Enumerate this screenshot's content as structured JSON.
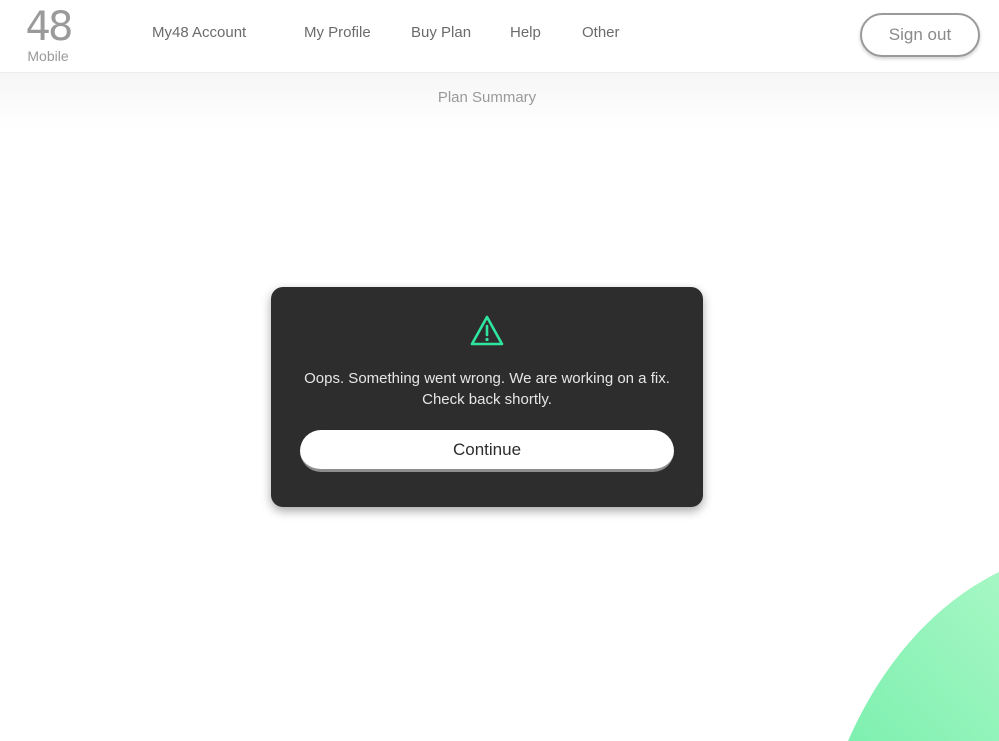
{
  "header": {
    "logo_number": "48",
    "logo_subtext": "Mobile",
    "nav": [
      {
        "label": "My48 Account"
      },
      {
        "label": "My Profile"
      },
      {
        "label": "Buy Plan"
      },
      {
        "label": "Help"
      },
      {
        "label": "Other"
      }
    ],
    "sign_out_label": "Sign out"
  },
  "subbar": {
    "title": "Plan Summary"
  },
  "modal": {
    "icon": "warning-triangle-icon",
    "message_line1": "Oops. Something went wrong. We are working on a fix.",
    "message_line2": "Check back shortly.",
    "continue_label": "Continue"
  },
  "colors": {
    "accent_green": "#2ee6a0",
    "blob_green": "#8ef5b8",
    "modal_bg": "#2e2d2d"
  }
}
